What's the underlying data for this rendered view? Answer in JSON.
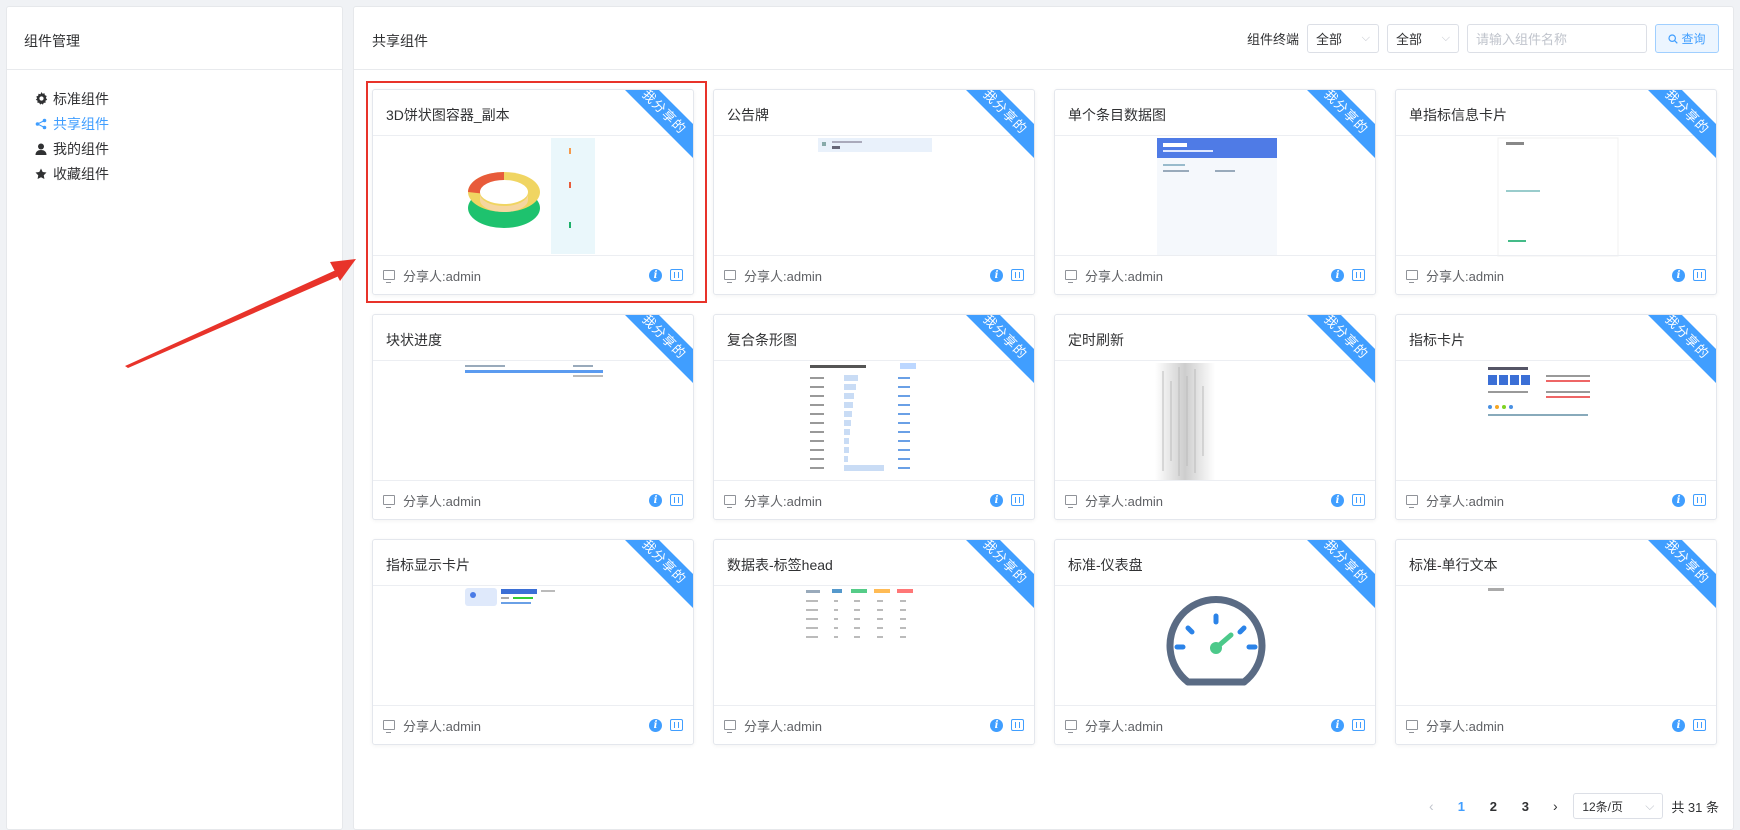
{
  "sidebar": {
    "title": "组件管理",
    "items": [
      {
        "label": "标准组件",
        "icon": "gear-icon",
        "active": false
      },
      {
        "label": "共享组件",
        "icon": "share-icon",
        "active": true
      },
      {
        "label": "我的组件",
        "icon": "user-icon",
        "active": false
      },
      {
        "label": "收藏组件",
        "icon": "star-icon",
        "active": false
      }
    ]
  },
  "main": {
    "title": "共享组件",
    "filter_label": "组件终端",
    "select1": "全部",
    "select2": "全部",
    "search_placeholder": "请输入组件名称",
    "search_button": "查询"
  },
  "ribbon_text": "我分享的",
  "share_prefix": "分享人:",
  "cards": [
    {
      "title": "3D饼状图容器_副本",
      "sharer": "admin",
      "thumb": "pie3d"
    },
    {
      "title": "公告牌",
      "sharer": "admin",
      "thumb": "notice"
    },
    {
      "title": "单个条目数据图",
      "sharer": "admin",
      "thumb": "single"
    },
    {
      "title": "单指标信息卡片",
      "sharer": "admin",
      "thumb": "indicator"
    },
    {
      "title": "块状进度",
      "sharer": "admin",
      "thumb": "progress"
    },
    {
      "title": "复合条形图",
      "sharer": "admin",
      "thumb": "bars"
    },
    {
      "title": "定时刷新",
      "sharer": "admin",
      "thumb": "refresh"
    },
    {
      "title": "指标卡片",
      "sharer": "admin",
      "thumb": "metric"
    },
    {
      "title": "指标显示卡片",
      "sharer": "admin",
      "thumb": "metricshow"
    },
    {
      "title": "数据表-标签head",
      "sharer": "admin",
      "thumb": "table"
    },
    {
      "title": "标准-仪表盘",
      "sharer": "admin",
      "thumb": "gauge"
    },
    {
      "title": "标准-单行文本",
      "sharer": "admin",
      "thumb": "text"
    }
  ],
  "pagination": {
    "pages": [
      "1",
      "2",
      "3"
    ],
    "current": "1",
    "page_size": "12条/页",
    "total": "共 31 条"
  },
  "colors": {
    "accent": "#409eff",
    "highlight": "#e8332a"
  }
}
